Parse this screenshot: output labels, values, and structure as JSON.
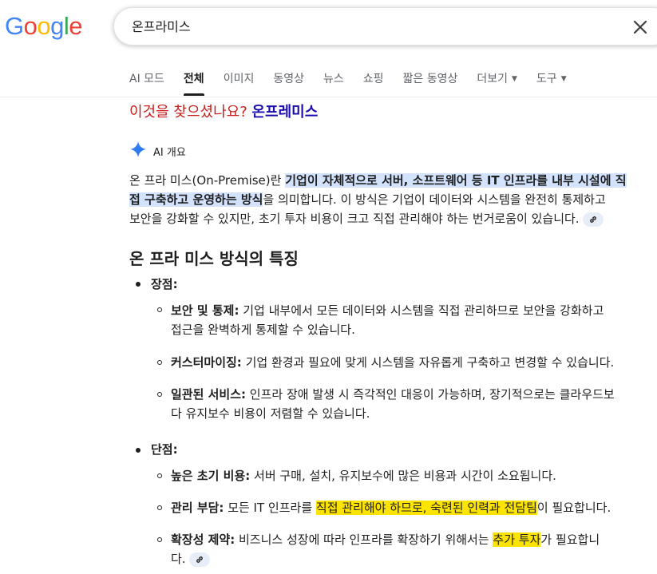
{
  "header": {
    "logo_letters": [
      "G",
      "o",
      "o",
      "g",
      "l",
      "e"
    ],
    "logo_colors": [
      "#4285f4",
      "#ea4335",
      "#fbbc05",
      "#4285f4",
      "#34a853",
      "#ea4335"
    ],
    "search_value": "온프라미스",
    "clear_icon": "close-icon"
  },
  "tabs": [
    {
      "label": "AI 모드",
      "active": false
    },
    {
      "label": "전체",
      "active": true
    },
    {
      "label": "이미지",
      "active": false
    },
    {
      "label": "동영상",
      "active": false
    },
    {
      "label": "뉴스",
      "active": false
    },
    {
      "label": "쇼핑",
      "active": false
    },
    {
      "label": "짧은 동영상",
      "active": false
    },
    {
      "label": "더보기",
      "active": false
    },
    {
      "label": "도구",
      "active": false
    }
  ],
  "did_you_mean": {
    "prefix": "이것을 찾으셨나요?",
    "suggestion": "온프레미스"
  },
  "ai_overview": {
    "label": "AI 개요",
    "intro_lead": "온 프라 미스(On-Premise)란 ",
    "intro_highlight_1": "기업이 자체적으로 서버, 소프트웨어 등 IT 인프라를 내부 시설에 직",
    "intro_highlight_2": "접 구축하고 운영하는 방식",
    "intro_rest_1": "을 의미합니다. 이 방식은 기업이 데이터와 시스템을 완전히 통제하고",
    "intro_rest_2": "보안을 강화할 수 있지만, 초기 투자 비용이 크고 직접 관리해야 하는 번거로움이 있습니다.",
    "heading": "온 프라 미스 방식의 특징",
    "pros_title": "장점:",
    "pros": [
      {
        "title": "보안 및 통제:",
        "text_1": " 기업 내부에서 모든 데이터와 시스템을 직접 관리하므로 보안을 강화하고",
        "text_2": "접근을 완벽하게 통제할 수 있습니다."
      },
      {
        "title": "커스터마이징:",
        "text_1": " 기업 환경과 필요에 맞게 시스템을 자유롭게 구축하고 변경할 수 있습니다."
      },
      {
        "title": "일관된 서비스:",
        "text_1": " 인프라 장애 발생 시 즉각적인 대응이 가능하며, 장기적으로는 클라우드보",
        "text_2": "다 유지보수 비용이 저렴할 수 있습니다."
      }
    ],
    "cons_title": "단점:",
    "cons": [
      {
        "title": "높은 초기 비용:",
        "text_1": " 서버 구매, 설치, 유지보수에 많은 비용과 시간이 소요됩니다."
      },
      {
        "title": "관리 부담:",
        "text_pre": " 모든 IT 인프라를 ",
        "text_hl_1": "직접 관리해야 하므로, 숙련된 인력과 전담팀",
        "text_post": "이 필요합니다."
      },
      {
        "title": "확장성 제약:",
        "text_pre": " 비즈니스 성장에 따라 인프라를 확장하기 위해서는 ",
        "text_hl_1": "추가 투자",
        "text_post": "가 필요합니",
        "text_2": "다."
      }
    ]
  }
}
